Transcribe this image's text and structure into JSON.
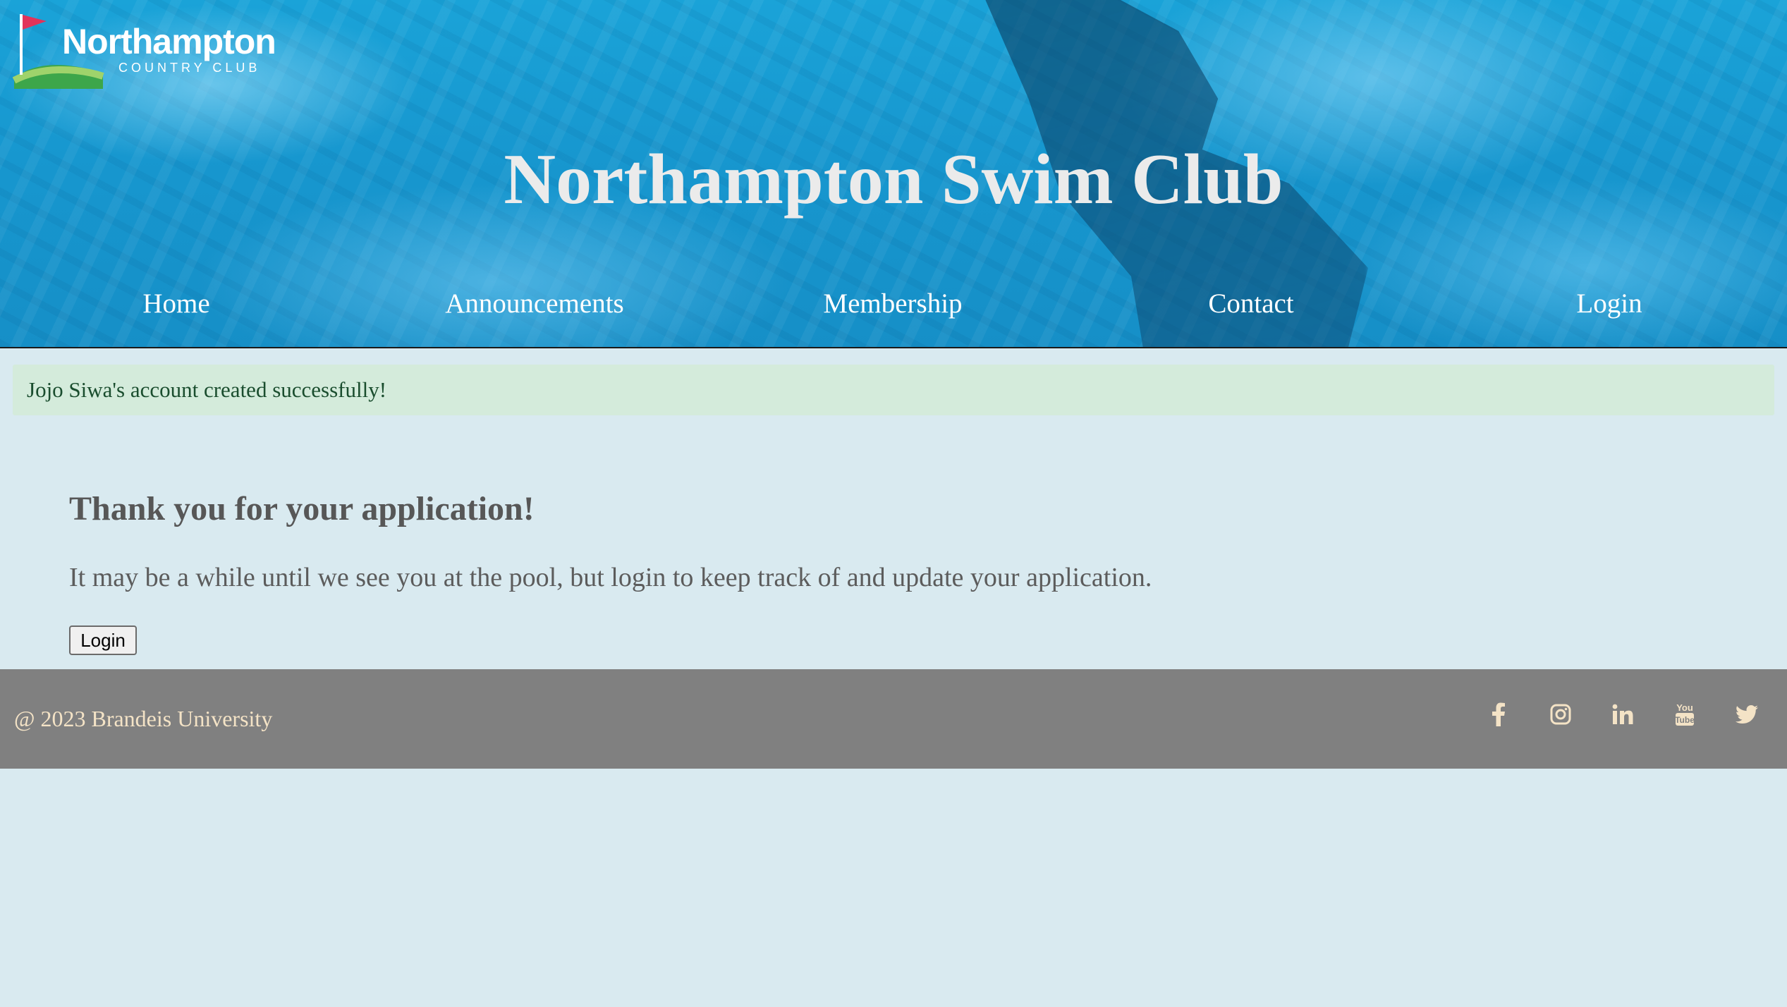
{
  "logo": {
    "name": "Northampton",
    "tagline": "COUNTRY CLUB",
    "colors": {
      "flag": "#e2335a",
      "hill_light": "#9fd36b",
      "hill_dark": "#3da64a",
      "text": "#ffffff"
    }
  },
  "header": {
    "title": "Northampton Swim Club",
    "background": "pool water photo",
    "nav": [
      {
        "label": "Home"
      },
      {
        "label": "Announcements"
      },
      {
        "label": "Membership"
      },
      {
        "label": "Contact"
      },
      {
        "label": "Login"
      }
    ]
  },
  "flash": {
    "message": "Jojo Siwa's account created successfully!",
    "colors": {
      "background": "#d4ebdb",
      "text": "#1a4d2e"
    }
  },
  "main": {
    "heading": "Thank you for your application!",
    "text": "It may be a while until we see you at the pool, but login to keep track of and update your application.",
    "button_label": "Login"
  },
  "footer": {
    "copyright": "@ 2023 Brandeis University",
    "social_icons": [
      "facebook-icon",
      "instagram-icon",
      "linkedin-icon",
      "youtube-icon",
      "twitter-icon"
    ],
    "colors": {
      "background": "#808080",
      "text": "#f4e3c6"
    }
  },
  "colors": {
    "page_background": "#d9eaf0",
    "water": "#1797cf",
    "heading_text": "#575757"
  }
}
